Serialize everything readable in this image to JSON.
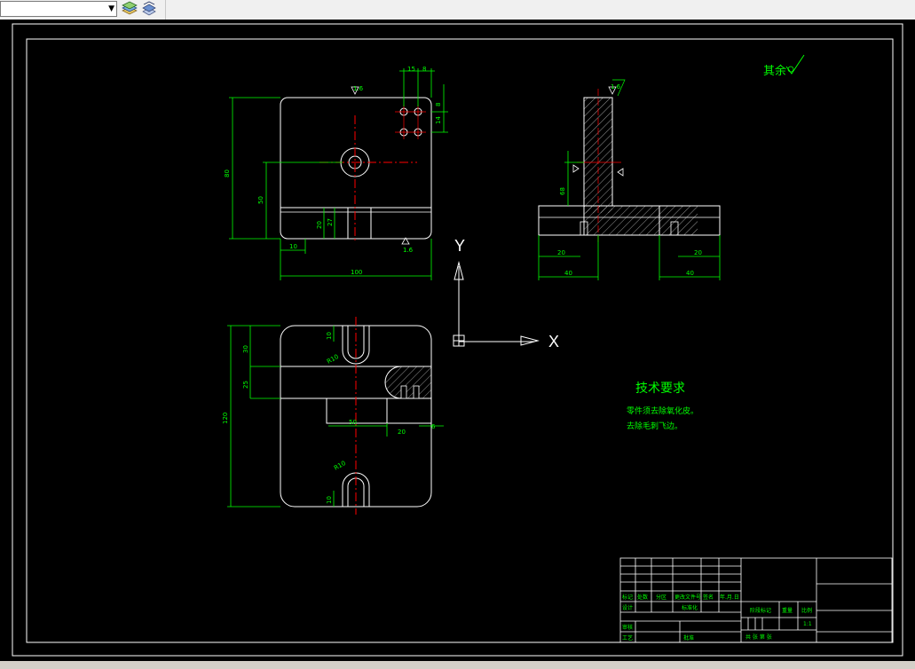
{
  "toolbar": {
    "layer_value": "",
    "layer_dropdown_icon": "chevron-down-icon",
    "layer_states_icon": "layer-states-icon",
    "layer_previous_icon": "layer-previous-icon"
  },
  "drawing": {
    "surface_note": "其余",
    "roughness_top": "1.6",
    "roughness_front": "1.6",
    "roughness_side": "1.6",
    "tech_title": "技术要求",
    "tech_line1": "零件须去除氧化皮。",
    "tech_line2": "去除毛刺飞边。",
    "axis_x": "X",
    "axis_y": "Y",
    "dims": {
      "front_width": "100",
      "front_height": "80",
      "front_mid": "50",
      "front_left": "10",
      "front_slot_a": "20",
      "front_slot_b": "27",
      "front_top_a": "15",
      "front_top_b": "8",
      "front_right_a": "8",
      "front_right_b": "14",
      "side_h": "40",
      "side_left_a": "20",
      "side_left_b": "40",
      "side_right_a": "20",
      "side_right_b": "40",
      "side_vertical": "68",
      "top_height": "120",
      "top_a": "30",
      "top_b": "25",
      "top_c": "10",
      "top_d": "10",
      "top_e": "50",
      "top_f": "20",
      "top_g": "6",
      "top_r1": "R10",
      "top_r2": "R10"
    },
    "title_block": {
      "row_labels": [
        "标记",
        "处数",
        "分区",
        "更改文件号",
        "签名",
        "年.月.日"
      ],
      "design": "设计",
      "standard": "标准化",
      "review": "审核",
      "process": "工艺",
      "approve": "批准",
      "stage": "阶段标记",
      "weight": "重量",
      "scale": "比例",
      "scale_value": "1:1",
      "sheets": "共 张 第 张"
    },
    "colors": {
      "outline": "#ffffff",
      "dimension": "#00ff00",
      "centerline": "#ff0000",
      "text": "#00ff00",
      "background": "#000000"
    }
  }
}
